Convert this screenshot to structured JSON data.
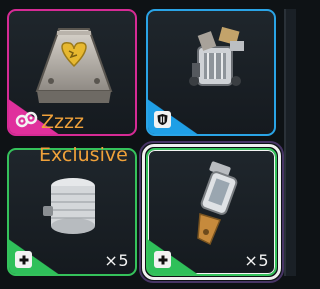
{
  "tiles": [
    {
      "id": "tile-1",
      "rarity_color": "#d62b95",
      "icon": "heart-crate-icon",
      "badge_icon": "link-icon",
      "name": "Zzzz"
    },
    {
      "id": "tile-2",
      "rarity_color": "#2aa4e6",
      "icon": "jetpack-device-icon",
      "badge_icon": "shield-icon"
    },
    {
      "id": "tile-3",
      "rarity_color": "#35c25b",
      "icon": "canister-icon",
      "badge_icon": "plus-icon",
      "count": "×5"
    },
    {
      "id": "tile-4",
      "rarity_color": "#35c25b",
      "icon": "injector-icon",
      "badge_icon": "plus-icon",
      "count": "×5",
      "selected": true
    }
  ],
  "overlay_label": "Exclusive"
}
